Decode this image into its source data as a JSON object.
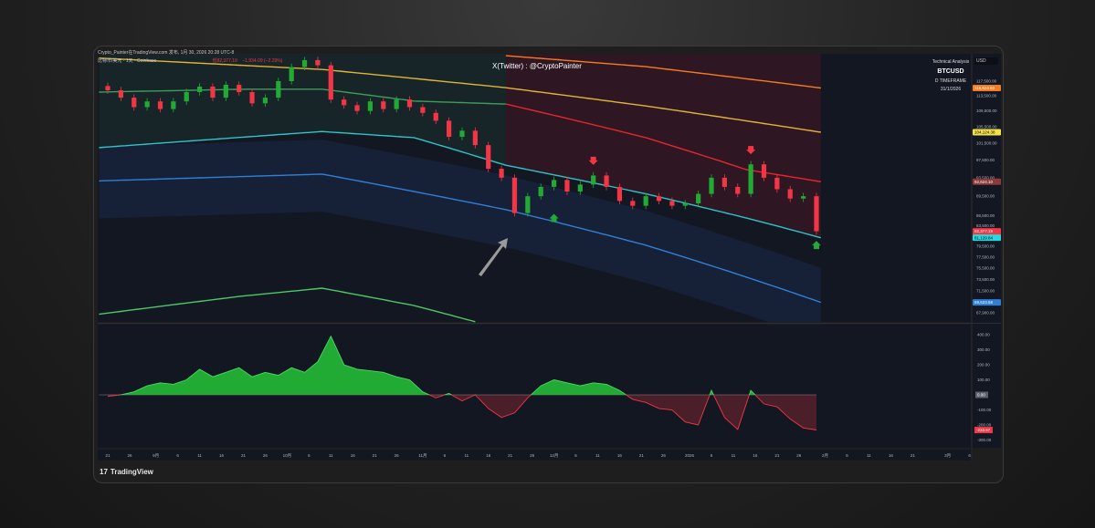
{
  "header": {
    "publish_line": "Crypto_Painter在TradingView.com 发布, 1月 30, 2026 20:28 UTC-8",
    "symbol_line": "比特币/美元 · 1天 · Coinbase",
    "ohlc_low": "低82,377.19",
    "ohlc_change": "−1,934.09 (−2.29%)"
  },
  "watermark": "X(Twitter) : @CryptoPainter",
  "info": {
    "title": "Technical Analysis",
    "symbol": "BTCUSD",
    "timeframe": "D TIMEFRAME",
    "date": "31/1/2026"
  },
  "currency": "USD",
  "footer": {
    "brand": "TradingView"
  },
  "colors": {
    "bg": "#131722",
    "up": "#26a69a",
    "bull": "#22ab34",
    "bear": "#f23645",
    "orange": "#f57c20",
    "yellow": "#e0b43a",
    "green": "#3f9d5a",
    "red": "#e5262f",
    "cyan": "#2ec4c9",
    "blue": "#2f7fd6",
    "lowgreen": "#4cc864"
  },
  "chart_data": {
    "type": "candlestick",
    "title": "BTCUSD D",
    "x_unit": "days since Aug 21 2025",
    "price_scale": "log",
    "ylim": [
      66500,
      126000
    ],
    "price_ticks": [
      "117,500.00",
      "113,500.00",
      "109,500.00",
      "105,500.00",
      "101,500.00",
      "97,500.00",
      "93,500.00",
      "89,500.00",
      "86,500.00",
      "83,500.00",
      "79,500.00",
      "77,500.00",
      "75,500.00",
      "73,500.00",
      "71,500.00",
      "67,900.00"
    ],
    "price_tick_values": [
      117500,
      113500,
      109500,
      105500,
      101500,
      97500,
      93500,
      89500,
      85500,
      83500,
      79500,
      77500,
      75500,
      73500,
      71500,
      67900
    ],
    "price_badges": [
      {
        "label": "115,624.63",
        "value": 115624.63,
        "color": "#f57c20"
      },
      {
        "label": "104,124.38",
        "value": 104124.38,
        "color": "#f2e14b",
        "text": "#000"
      },
      {
        "label": "92,624.10",
        "value": 92624.1,
        "color": "#8b3a3a"
      },
      {
        "label": "82,377.19",
        "sub": "11:31:58",
        "value": 82377.19,
        "color": "#f23645"
      },
      {
        "label": "81,129.84",
        "value": 81129.84,
        "color": "#26d9e0",
        "text": "#000"
      },
      {
        "label": "69,623.58",
        "value": 69623.58,
        "color": "#2f7fd6"
      }
    ],
    "step_days": 3,
    "closes": [
      115000,
      113000,
      110500,
      112000,
      110000,
      112000,
      114500,
      116000,
      113000,
      116500,
      114500,
      111500,
      113000,
      117500,
      121500,
      123500,
      122000,
      112500,
      111000,
      109500,
      112000,
      110000,
      112500,
      110500,
      109000,
      107000,
      103000,
      104500,
      101000,
      95500,
      93500,
      86000,
      89500,
      91500,
      93000,
      90500,
      92000,
      94000,
      91500,
      88500,
      87500,
      89500,
      88500,
      87500,
      88000,
      90000,
      93500,
      91500,
      90000,
      96500,
      93500,
      91000,
      89000,
      89500,
      82377.19
    ],
    "bands": [
      {
        "name": "orange",
        "color": "#f57c20",
        "points": [
          [
            91,
            124800
          ],
          [
            123,
            121600
          ],
          [
            163,
            115624
          ]
        ]
      },
      {
        "name": "yellow",
        "color": "#e0b43a",
        "points": [
          [
            -2,
            124100
          ],
          [
            49,
            120800
          ],
          [
            91,
            115700
          ],
          [
            123,
            110800
          ],
          [
            163,
            104124
          ]
        ]
      },
      {
        "name": "green-ma",
        "color": "#3f9d5a",
        "points": [
          [
            -2,
            114500
          ],
          [
            32,
            115300
          ],
          [
            49,
            115300
          ],
          [
            70,
            112100
          ],
          [
            91,
            111300
          ]
        ]
      },
      {
        "name": "red-ma",
        "color": "#e5262f",
        "points": [
          [
            91,
            111300
          ],
          [
            123,
            102800
          ],
          [
            146,
            95300
          ],
          [
            163,
            92624
          ]
        ]
      },
      {
        "name": "cyan",
        "color": "#2ec4c9",
        "points": [
          [
            -2,
            100400
          ],
          [
            49,
            104300
          ],
          [
            70,
            102800
          ],
          [
            91,
            96300
          ],
          [
            123,
            90000
          ],
          [
            146,
            85000
          ],
          [
            163,
            81129
          ]
        ]
      },
      {
        "name": "blue",
        "color": "#2f7fd6",
        "points": [
          [
            -2,
            92800
          ],
          [
            49,
            94300
          ],
          [
            91,
            86700
          ],
          [
            123,
            79700
          ],
          [
            163,
            69623
          ]
        ]
      },
      {
        "name": "low-green",
        "color": "#4cc864",
        "points": [
          [
            -2,
            67700
          ],
          [
            30,
            70600
          ],
          [
            49,
            72000
          ],
          [
            70,
            69100
          ],
          [
            84,
            66500
          ]
        ]
      }
    ],
    "signals": [
      {
        "type": "sell",
        "day": 111,
        "price": 97000
      },
      {
        "type": "sell",
        "day": 147,
        "price": 99500
      },
      {
        "type": "buy",
        "day": 102,
        "price": 85300
      },
      {
        "type": "buy",
        "day": 162,
        "price": 80000
      }
    ],
    "oscillator": {
      "ylim": [
        -330,
        430
      ],
      "ticks": [
        "400.00",
        "300.00",
        "200.00",
        "100.00",
        "-100.00",
        "-200.00",
        "-300.00"
      ],
      "tick_values": [
        400,
        300,
        200,
        100,
        -100,
        -200,
        -300
      ],
      "zero_badge": "0.00",
      "last_badge": "-233.57",
      "last_value": -233.57,
      "values": [
        -10,
        0,
        20,
        60,
        80,
        70,
        100,
        170,
        120,
        150,
        180,
        120,
        150,
        130,
        180,
        150,
        220,
        390,
        200,
        170,
        160,
        150,
        120,
        100,
        20,
        -20,
        10,
        -40,
        0,
        -90,
        -150,
        -120,
        -20,
        60,
        100,
        80,
        60,
        80,
        70,
        30,
        -30,
        -50,
        -90,
        -100,
        -180,
        -200,
        30,
        -150,
        -230,
        30,
        -60,
        -80,
        -160,
        -220,
        -233.57
      ]
    },
    "time_ticks": [
      {
        "label": "21",
        "d": 0
      },
      {
        "label": "26",
        "d": 5
      },
      {
        "label": "9月",
        "d": 11
      },
      {
        "label": "6",
        "d": 16
      },
      {
        "label": "11",
        "d": 21
      },
      {
        "label": "16",
        "d": 26
      },
      {
        "label": "21",
        "d": 31
      },
      {
        "label": "26",
        "d": 36
      },
      {
        "label": "10月",
        "d": 41
      },
      {
        "label": "6",
        "d": 46
      },
      {
        "label": "11",
        "d": 51
      },
      {
        "label": "16",
        "d": 56
      },
      {
        "label": "21",
        "d": 61
      },
      {
        "label": "26",
        "d": 66
      },
      {
        "label": "11月",
        "d": 72
      },
      {
        "label": "6",
        "d": 77
      },
      {
        "label": "11",
        "d": 82
      },
      {
        "label": "16",
        "d": 87
      },
      {
        "label": "21",
        "d": 92
      },
      {
        "label": "26",
        "d": 97
      },
      {
        "label": "12月",
        "d": 102
      },
      {
        "label": "6",
        "d": 107
      },
      {
        "label": "11",
        "d": 112
      },
      {
        "label": "16",
        "d": 117
      },
      {
        "label": "21",
        "d": 122
      },
      {
        "label": "26",
        "d": 127
      },
      {
        "label": "2026",
        "d": 133
      },
      {
        "label": "6",
        "d": 138
      },
      {
        "label": "11",
        "d": 143
      },
      {
        "label": "16",
        "d": 148
      },
      {
        "label": "21",
        "d": 153
      },
      {
        "label": "26",
        "d": 158
      },
      {
        "label": "2月",
        "d": 164
      },
      {
        "label": "6",
        "d": 169
      },
      {
        "label": "11",
        "d": 174
      },
      {
        "label": "16",
        "d": 179
      },
      {
        "label": "21",
        "d": 184
      },
      {
        "label": "3月",
        "d": 192
      },
      {
        "label": "6",
        "d": 197
      }
    ]
  }
}
